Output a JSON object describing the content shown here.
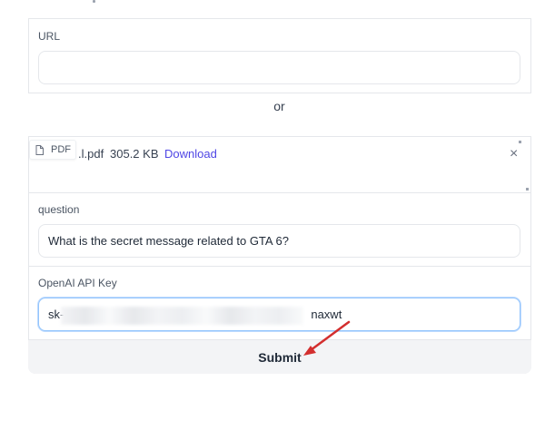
{
  "url_field": {
    "label": "URL",
    "value": ""
  },
  "separator": {
    "text": "or"
  },
  "file": {
    "badge": "PDF",
    "name": ".l.pdf",
    "size": "305.2 KB",
    "download_label": "Download",
    "close_symbol": "×",
    "icon": "file-icon"
  },
  "question_field": {
    "label": "question",
    "value": "What is the secret message related to GTA 6?"
  },
  "api_key_field": {
    "label": "OpenAI API Key",
    "value_prefix": "sk-",
    "value_suffix": "naxwt"
  },
  "submit": {
    "label": "Submit"
  },
  "colors": {
    "accent_link": "#4f46e5",
    "focus_border": "#93c5fd",
    "annotation_arrow": "#d32f2f"
  }
}
